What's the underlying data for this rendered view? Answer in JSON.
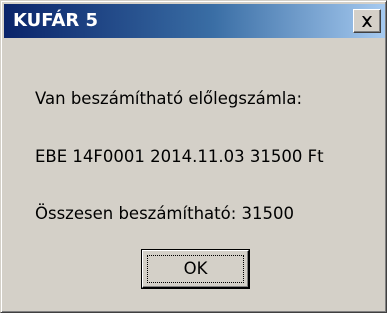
{
  "window": {
    "title": "KUFÁR 5",
    "close_icon": "close-icon"
  },
  "message": {
    "line1": "Van beszámítható előlegszámla:",
    "line2": "EBE 14F0001 2014.11.03 31500 Ft",
    "line3": "Összesen beszámítható: 31500"
  },
  "buttons": {
    "ok_label": "OK"
  },
  "colors": {
    "titlebar_start": "#0a246a",
    "titlebar_end": "#a6caf0",
    "dialog_background": "#d4d0c8"
  }
}
